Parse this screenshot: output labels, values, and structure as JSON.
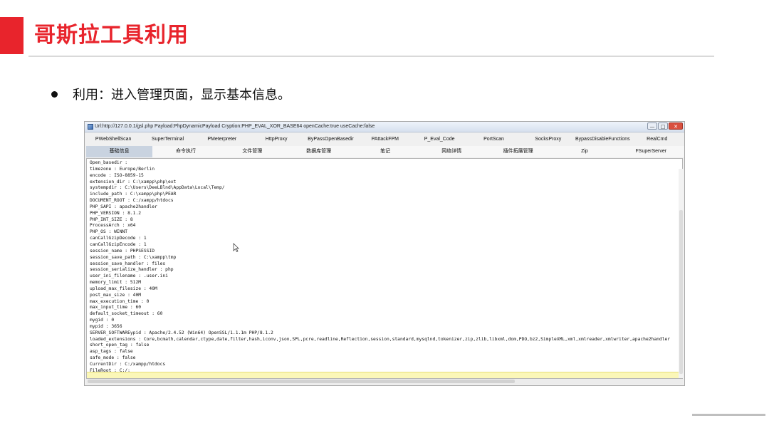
{
  "slide": {
    "title": "哥斯拉工具利用",
    "bullet": "利用：进入管理页面，显示基本信息。"
  },
  "colors": {
    "accent": "#e8242c",
    "rule": "#d9d9d9",
    "command_bar": "#fbf7b8"
  },
  "window": {
    "title": "Url:http://127.0.0.1/gsl.php Payload:PhpDynamicPayload Cryption:PHP_EVAL_XOR_BASE64 openCache:true useCache:false",
    "buttons": {
      "minimize": "—",
      "maximize": "□",
      "close": "✕"
    },
    "tabs_primary": [
      "PWebShellScan",
      "SuperTerminal",
      "PMeterpreter",
      "HttpProxy",
      "ByPassOpenBasedir",
      "PAttackFPM",
      "P_Eval_Code",
      "PortScan",
      "SocksProxy",
      "BypassDisableFunctions",
      "RealCmd"
    ],
    "tabs_secondary": [
      "基础信息",
      "命令执行",
      "文件管理",
      "数据库管理",
      "笔记",
      "网络详情",
      "插件拓展管理",
      "Zip",
      "FSuperServer"
    ],
    "active_secondary": 0,
    "output": [
      "Open_basedir :",
      "timezone : Europe/Berlin",
      "encode : ISO-8859-15",
      "extension_dir : C:\\xampp\\php\\ext",
      "systempdir : C:\\Users\\DeeLBlnd\\AppData\\Local\\Temp/",
      "include_path : C:\\xampp\\php\\PEAR",
      "DOCUMENT_ROOT : C:/xampp/htdocs",
      "PHP_SAPI : apache2handler",
      "PHP_VERSION : 8.1.2",
      "PHP_INT_SIZE : 8",
      "ProcessArch : x64",
      "PHP_OS : WINNT",
      "canCallGzipDecode : 1",
      "canCallGzipEncode : 1",
      "session_name : PHPSESSID",
      "session_save_path : C:\\xampp\\tmp",
      "session_save_handler : files",
      "session_serialize_handler : php",
      "user_ini_filename : .user.ini",
      "memory_limit : 512M",
      "upload_max_filesize : 40M",
      "post_max_size : 40M",
      "max_execution_time : 0",
      "max_input_time : 60",
      "default_socket_timeout : 60",
      "mygid : 0",
      "mypid : 3656",
      "SERVER_SOFTWAREypid : Apache/2.4.52 (Win64) OpenSSL/1.1.1m PHP/8.1.2",
      "loaded_extensions : Core,bcmath,calendar,ctype,date,filter,hash,iconv,json,SPL,pcre,readline,Reflection,session,standard,mysqlnd,tokenizer,zip,zlib,libxml,dom,PDO,bz2,SimpleXML,xml,xmlreader,xmlwriter,apache2handler",
      "short_open_tag : false",
      "asp_tags : false",
      "safe_mode : false",
      "CurrentDir : C:/xampp/htdocs",
      "FileRoot : C:/;"
    ]
  }
}
